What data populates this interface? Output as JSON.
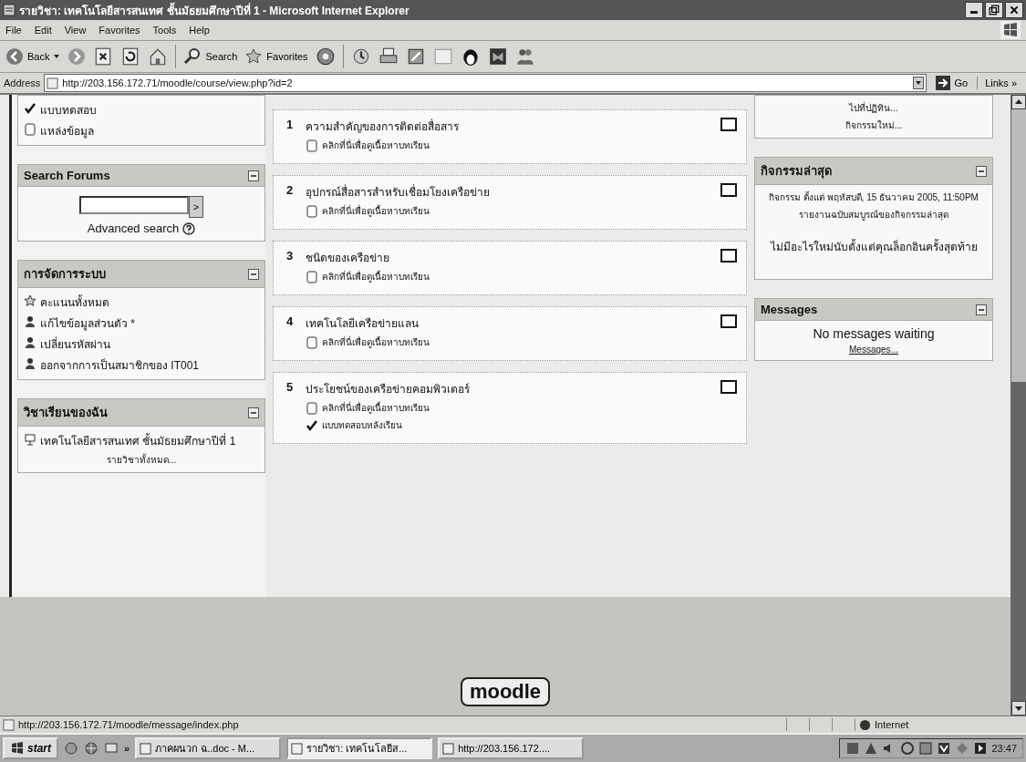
{
  "window": {
    "title": "รายวิชา: เทคโนโลยีสารสนเทศ ชั้นมัธยมศึกษาปีที่ 1 - Microsoft Internet Explorer"
  },
  "menu": [
    "File",
    "Edit",
    "View",
    "Favorites",
    "Tools",
    "Help"
  ],
  "toolbar": {
    "back": "Back",
    "search": "Search",
    "favorites": "Favorites"
  },
  "address": {
    "label": "Address",
    "value": "http://203.156.172.71/moodle/course/view.php?id=2",
    "go": "Go",
    "links": "Links",
    "more": "»"
  },
  "left_blocks": [
    {
      "kind": "list",
      "items": [
        {
          "kind": "check",
          "label": "แบบทดสอบ"
        },
        {
          "kind": "page",
          "label": "แหล่งข้อมูล"
        }
      ]
    },
    {
      "kind": "search",
      "title": "Search Forums",
      "button": ">",
      "link": "Advanced search"
    },
    {
      "kind": "list",
      "title": "การจัดการระบบ",
      "items": [
        {
          "kind": "star",
          "label": "คะแนนทั้งหมด"
        },
        {
          "kind": "person",
          "label": "แก้ไขข้อมูลส่วนตัว *"
        },
        {
          "kind": "person",
          "label": "เปลี่ยนรหัสผ่าน"
        },
        {
          "kind": "person",
          "label": "ออกจากการเป็นสมาชิกของ IT001"
        }
      ]
    },
    {
      "kind": "courses",
      "title": "วิชาเรียนของฉัน",
      "items": [
        {
          "label": "เทคโนโลยีสารสนเทศ ชั้นมัธยมศึกษาปีที่ 1"
        }
      ],
      "link": "รายวิชาทั้งหมด..."
    }
  ],
  "sections": [
    {
      "number": "1",
      "title": "ความสำคัญของการติดต่อสื่อสาร",
      "checked": false,
      "resources": [
        {
          "kind": "page",
          "label": "คลิกที่นี่เพื่อดูเนื้อหาบทเรียน"
        }
      ]
    },
    {
      "number": "2",
      "title": "อุปกรณ์สื่อสารสำหรับเชื่อมโยงเครือข่าย",
      "checked": false,
      "resources": [
        {
          "kind": "page",
          "label": "คลิกที่นี่เพื่อดูเนื้อหาบทเรียน"
        }
      ]
    },
    {
      "number": "3",
      "title": "ชนิดของเครือข่าย",
      "checked": false,
      "resources": [
        {
          "kind": "page",
          "label": "คลิกที่นี่เพื่อดูเนื้อหาบทเรียน"
        }
      ]
    },
    {
      "number": "4",
      "title": "เทคโนโลยีเครือข่ายแลน",
      "checked": false,
      "resources": [
        {
          "kind": "page",
          "label": "คลิกที่นี่เพื่อดูเนื้อหาบทเรียน"
        }
      ]
    },
    {
      "number": "5",
      "title": "ประโยชน์ของเครือข่ายคอมพิวเตอร์",
      "checked": false,
      "resources": [
        {
          "kind": "page",
          "label": "คลิกที่นี่เพื่อดูเนื้อหาบทเรียน"
        },
        {
          "kind": "quiz",
          "label": "แบบทดสอบหลังเรียน"
        }
      ]
    }
  ],
  "right_blocks": [
    {
      "kind": "links",
      "links": [
        "ไปที่ปฏิทิน...",
        "กิจกรรมใหม่..."
      ]
    },
    {
      "kind": "recent",
      "title": "กิจกรรมล่าสุด",
      "since": "กิจกรรม ตั้งแต่ พฤหัสบดี, 15 ธันวาคม 2005, 11:50PM",
      "report": "รายงานฉบับสมบูรณ์ของกิจกรรมล่าสุด",
      "note": "ไม่มีอะไรใหม่นับตั้งแต่คุณล็อกอินครั้งสุดท้าย"
    },
    {
      "kind": "messages",
      "title": "Messages",
      "text": "No messages waiting",
      "link": "Messages..."
    }
  ],
  "footer": {
    "logo": "moodle"
  },
  "status_bar": {
    "url": "http://203.156.172.71/moodle/message/index.php",
    "zone": "Internet"
  },
  "taskbar": {
    "start": "start",
    "more": "»",
    "tasks": [
      {
        "label": "ภาคผนวก ฉ..doc - M...",
        "selected": false
      },
      {
        "label": "รายวิชา: เทคโนโลยีส...",
        "selected": true
      },
      {
        "label": "http://203.156.172....",
        "selected": false
      }
    ],
    "clock": "23:47"
  }
}
